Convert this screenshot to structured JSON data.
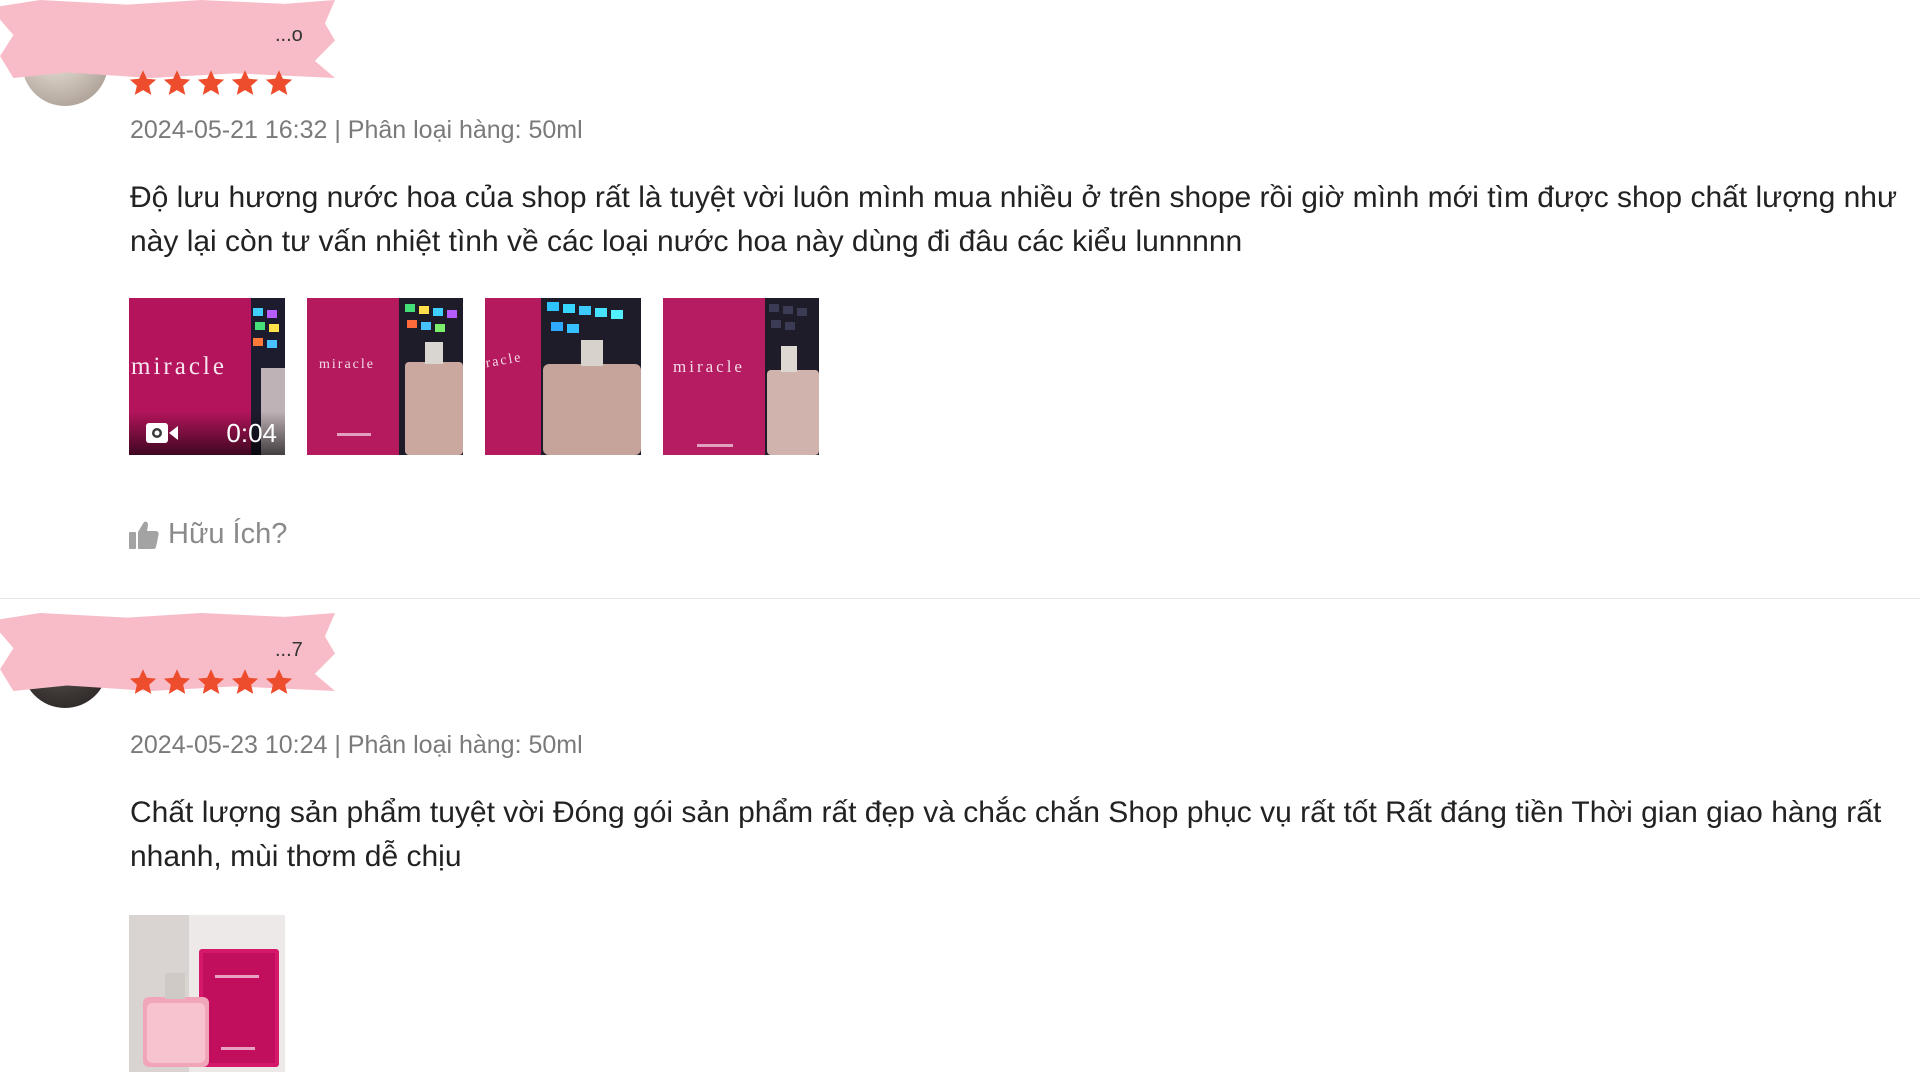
{
  "reviews": [
    {
      "username": "...o",
      "rating": 5,
      "meta": "2024-05-21 16:32 | Phân loại hàng: 50ml",
      "content": "Độ lưu hương nước hoa của shop rất là tuyệt vời luôn mình mua nhiều ở trên shope rồi giờ mình mới tìm được shop chất lượng như này lại còn tư vấn nhiệt tình về các loại nước hoa này dùng đi đâu các kiểu lunnnnn",
      "media": [
        {
          "type": "video",
          "duration": "0:04",
          "caption": "miracle"
        },
        {
          "type": "image",
          "caption": "miracle"
        },
        {
          "type": "image",
          "caption": "racle"
        },
        {
          "type": "image",
          "caption": "miracle"
        }
      ],
      "helpful_label": "Hữu Ích?"
    },
    {
      "username": "...7",
      "rating": 5,
      "meta": "2024-05-23 10:24 | Phân loại hàng: 50ml",
      "content": "Chất lượng sản phẩm tuyệt vời Đóng gói sản phẩm rất đẹp và chắc chắn Shop phục vụ rất tốt Rất đáng tiền Thời gian giao hàng rất nhanh, mùi thơm dễ chịu",
      "media": [
        {
          "type": "image"
        }
      ]
    }
  ],
  "colors": {
    "star": "#ee4d2d",
    "meta_text": "#7a7a7a",
    "redaction": "#f8bcc8"
  },
  "icons": {
    "star": "star-icon",
    "video": "video-camera-icon",
    "helpful": "thumbs-up-icon"
  }
}
